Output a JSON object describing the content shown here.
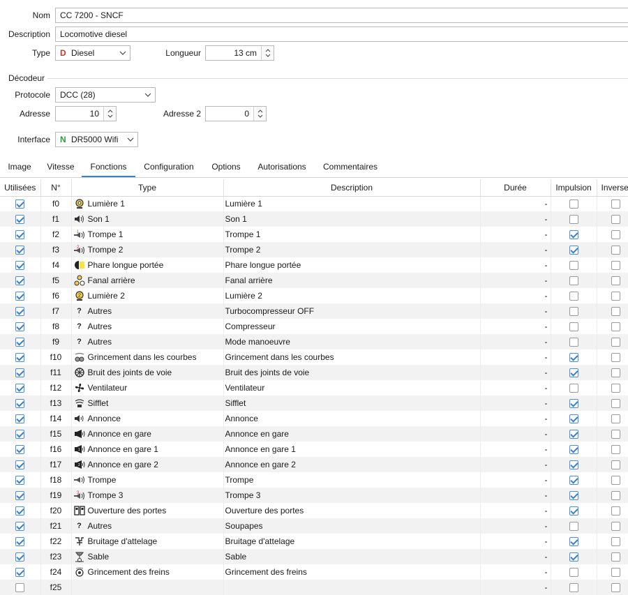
{
  "form": {
    "nom_label": "Nom",
    "nom_value": "CC 7200 - SNCF",
    "description_label": "Description",
    "description_value": "Locomotive diesel",
    "type_label": "Type",
    "type_badge": "D",
    "type_value": "Diesel",
    "longueur_label": "Longueur",
    "longueur_value": "13 cm",
    "decodeur_label": "Décodeur",
    "protocole_label": "Protocole",
    "protocole_value": "DCC (28)",
    "adresse_label": "Adresse",
    "adresse_value": "10",
    "adresse2_label": "Adresse 2",
    "adresse2_value": "0",
    "interface_label": "Interface",
    "interface_badge": "N",
    "interface_value": "DR5000 Wifi",
    "type_badge_color": "#c0392b",
    "interface_badge_color": "#2e9e3e"
  },
  "tabs": [
    {
      "label": "Image"
    },
    {
      "label": "Vitesse"
    },
    {
      "label": "Fonctions",
      "active": true
    },
    {
      "label": "Configuration"
    },
    {
      "label": "Options"
    },
    {
      "label": "Autorisations"
    },
    {
      "label": "Commentaires"
    }
  ],
  "columns": {
    "used": "Utilisées",
    "num": "N°",
    "type": "Type",
    "description": "Description",
    "duration": "Durée",
    "impulse": "Impulsion",
    "inverse": "Inverse"
  },
  "rows": [
    {
      "used": true,
      "num": "f0",
      "icon": "light-icon",
      "type": "Lumière 1",
      "desc": "Lumière 1",
      "dur": "-",
      "impulse": false,
      "inverse": false
    },
    {
      "used": true,
      "num": "f1",
      "icon": "sound-icon",
      "type": "Son 1",
      "desc": "Son 1",
      "dur": "-",
      "impulse": false,
      "inverse": false
    },
    {
      "used": true,
      "num": "f2",
      "icon": "horn-1-icon",
      "type": "Trompe 1",
      "desc": "Trompe 1",
      "dur": "-",
      "impulse": true,
      "inverse": false
    },
    {
      "used": true,
      "num": "f3",
      "icon": "horn-2-icon",
      "type": "Trompe 2",
      "desc": "Trompe 2",
      "dur": "-",
      "impulse": true,
      "inverse": false
    },
    {
      "used": true,
      "num": "f4",
      "icon": "headlight-icon",
      "type": "Phare longue portée",
      "desc": "Phare longue portée",
      "dur": "-",
      "impulse": false,
      "inverse": false
    },
    {
      "used": true,
      "num": "f5",
      "icon": "rear-light-icon",
      "type": "Fanal arrière",
      "desc": "Fanal arrière",
      "dur": "-",
      "impulse": false,
      "inverse": false
    },
    {
      "used": true,
      "num": "f6",
      "icon": "light-2-icon",
      "type": "Lumière 2",
      "desc": "Lumière 2",
      "dur": "-",
      "impulse": false,
      "inverse": false
    },
    {
      "used": true,
      "num": "f7",
      "icon": "question-icon",
      "type": "Autres",
      "desc": "Turbocompresseur OFF",
      "dur": "-",
      "impulse": false,
      "inverse": false
    },
    {
      "used": true,
      "num": "f8",
      "icon": "question-icon",
      "type": "Autres",
      "desc": "Compresseur",
      "dur": "-",
      "impulse": false,
      "inverse": false
    },
    {
      "used": true,
      "num": "f9",
      "icon": "question-icon",
      "type": "Autres",
      "desc": "Mode manoeuvre",
      "dur": "-",
      "impulse": false,
      "inverse": false
    },
    {
      "used": true,
      "num": "f10",
      "icon": "curve-squeal-icon",
      "type": "Grincement dans les courbes",
      "desc": "Grincement dans les courbes",
      "dur": "-",
      "impulse": true,
      "inverse": false
    },
    {
      "used": true,
      "num": "f11",
      "icon": "rail-joint-icon",
      "type": "Bruit des joints de voie",
      "desc": "Bruit des joints de voie",
      "dur": "-",
      "impulse": true,
      "inverse": false
    },
    {
      "used": true,
      "num": "f12",
      "icon": "fan-icon",
      "type": "Ventilateur",
      "desc": "Ventilateur",
      "dur": "-",
      "impulse": false,
      "inverse": false
    },
    {
      "used": true,
      "num": "f13",
      "icon": "whistle-icon",
      "type": "Sifflet",
      "desc": "Sifflet",
      "dur": "-",
      "impulse": true,
      "inverse": false
    },
    {
      "used": true,
      "num": "f14",
      "icon": "announce-icon",
      "type": "Annonce",
      "desc": "Annonce",
      "dur": "-",
      "impulse": true,
      "inverse": false
    },
    {
      "used": true,
      "num": "f15",
      "icon": "station-announce-icon",
      "type": "Annonce en gare",
      "desc": "Annonce en gare",
      "dur": "-",
      "impulse": true,
      "inverse": false
    },
    {
      "used": true,
      "num": "f16",
      "icon": "station-announce-1-icon",
      "type": "Annonce en gare 1",
      "desc": "Annonce en gare 1",
      "dur": "-",
      "impulse": true,
      "inverse": false
    },
    {
      "used": true,
      "num": "f17",
      "icon": "station-announce-2-icon",
      "type": "Annonce en gare 2",
      "desc": "Annonce en gare 2",
      "dur": "-",
      "impulse": true,
      "inverse": false
    },
    {
      "used": true,
      "num": "f18",
      "icon": "horn-icon",
      "type": "Trompe",
      "desc": "Trompe",
      "dur": "-",
      "impulse": true,
      "inverse": false
    },
    {
      "used": true,
      "num": "f19",
      "icon": "horn-3-icon",
      "type": "Trompe 3",
      "desc": "Trompe 3",
      "dur": "-",
      "impulse": true,
      "inverse": false
    },
    {
      "used": true,
      "num": "f20",
      "icon": "doors-icon",
      "type": "Ouverture des portes",
      "desc": "Ouverture des portes",
      "dur": "-",
      "impulse": true,
      "inverse": false
    },
    {
      "used": true,
      "num": "f21",
      "icon": "question-icon",
      "type": "Autres",
      "desc": "Soupapes",
      "dur": "-",
      "impulse": false,
      "inverse": false
    },
    {
      "used": true,
      "num": "f22",
      "icon": "coupling-icon",
      "type": "Bruitage d'attelage",
      "desc": "Bruitage d'attelage",
      "dur": "-",
      "impulse": true,
      "inverse": false
    },
    {
      "used": true,
      "num": "f23",
      "icon": "sand-icon",
      "type": "Sable",
      "desc": "Sable",
      "dur": "-",
      "impulse": true,
      "inverse": false
    },
    {
      "used": true,
      "num": "f24",
      "icon": "brake-squeal-icon",
      "type": "Grincement des freins",
      "desc": "Grincement des freins",
      "dur": "-",
      "impulse": false,
      "inverse": false
    },
    {
      "used": false,
      "num": "f25",
      "icon": "",
      "type": "",
      "desc": "",
      "dur": "-",
      "impulse": false,
      "inverse": false
    }
  ]
}
